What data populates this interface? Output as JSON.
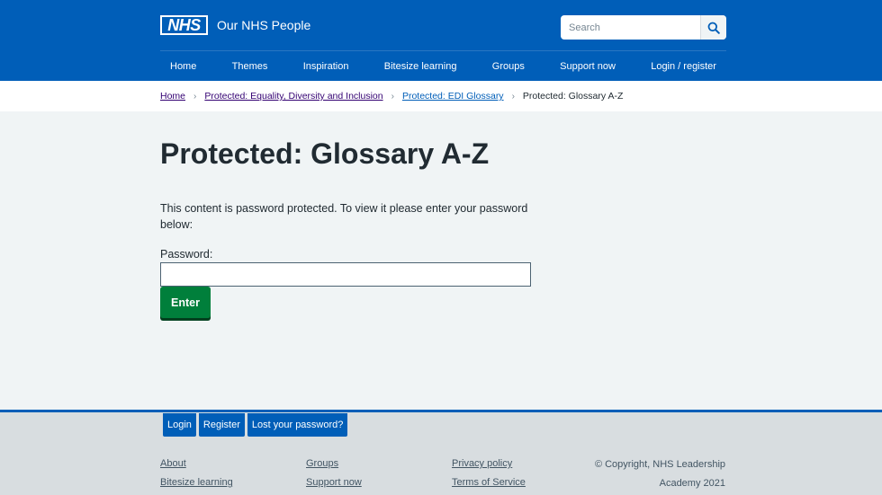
{
  "header": {
    "logo_text": "NHS",
    "site_name": "Our NHS People",
    "search_placeholder": "Search",
    "search_icon": "search-icon",
    "nav": [
      {
        "label": "Home"
      },
      {
        "label": "Themes"
      },
      {
        "label": "Inspiration"
      },
      {
        "label": "Bitesize learning"
      },
      {
        "label": "Groups"
      },
      {
        "label": "Support now"
      },
      {
        "label": "Login / register"
      }
    ]
  },
  "breadcrumb": {
    "items": [
      {
        "label": "Home"
      },
      {
        "label": "Protected: Equality, Diversity and Inclusion"
      },
      {
        "label": "Protected: EDI Glossary"
      }
    ],
    "current": "Protected: Glossary A-Z",
    "separator": "›"
  },
  "main": {
    "title": "Protected: Glossary A-Z",
    "intro": "This content is password protected. To view it please enter your password below:",
    "password_label": "Password:",
    "password_value": "",
    "enter_label": "Enter"
  },
  "footer": {
    "login_buttons": [
      {
        "label": "Login"
      },
      {
        "label": "Register"
      },
      {
        "label": "Lost your password?"
      }
    ],
    "links": [
      {
        "label": "About"
      },
      {
        "label": "Bitesize learning"
      },
      {
        "label": "Groups"
      },
      {
        "label": "Support now"
      },
      {
        "label": "Privacy policy"
      },
      {
        "label": "Terms of Service"
      }
    ],
    "copyright": "© Copyright, NHS Leadership Academy 2021"
  },
  "colors": {
    "nhs_blue": "#005eb8",
    "button_green": "#007f3b",
    "background": "#f0f4f5",
    "footer_background": "#d8dde0"
  }
}
